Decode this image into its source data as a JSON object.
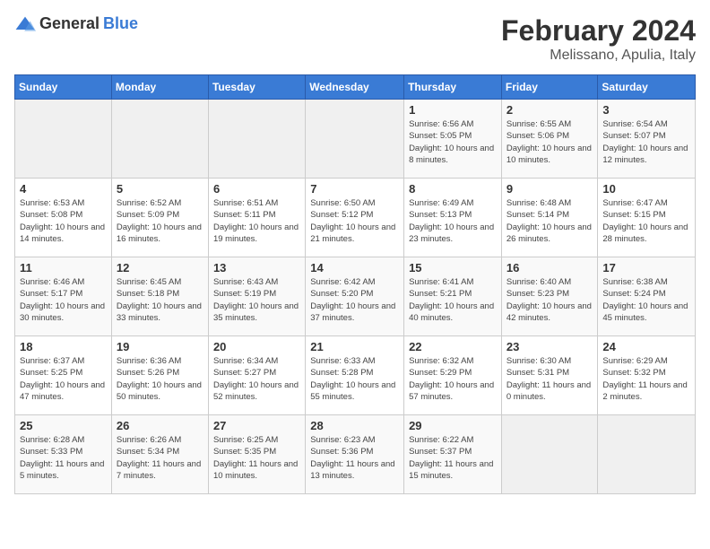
{
  "header": {
    "logo_general": "General",
    "logo_blue": "Blue",
    "month_year": "February 2024",
    "location": "Melissano, Apulia, Italy"
  },
  "days_of_week": [
    "Sunday",
    "Monday",
    "Tuesday",
    "Wednesday",
    "Thursday",
    "Friday",
    "Saturday"
  ],
  "weeks": [
    [
      {
        "day": "",
        "info": ""
      },
      {
        "day": "",
        "info": ""
      },
      {
        "day": "",
        "info": ""
      },
      {
        "day": "",
        "info": ""
      },
      {
        "day": "1",
        "info": "Sunrise: 6:56 AM\nSunset: 5:05 PM\nDaylight: 10 hours and 8 minutes."
      },
      {
        "day": "2",
        "info": "Sunrise: 6:55 AM\nSunset: 5:06 PM\nDaylight: 10 hours and 10 minutes."
      },
      {
        "day": "3",
        "info": "Sunrise: 6:54 AM\nSunset: 5:07 PM\nDaylight: 10 hours and 12 minutes."
      }
    ],
    [
      {
        "day": "4",
        "info": "Sunrise: 6:53 AM\nSunset: 5:08 PM\nDaylight: 10 hours and 14 minutes."
      },
      {
        "day": "5",
        "info": "Sunrise: 6:52 AM\nSunset: 5:09 PM\nDaylight: 10 hours and 16 minutes."
      },
      {
        "day": "6",
        "info": "Sunrise: 6:51 AM\nSunset: 5:11 PM\nDaylight: 10 hours and 19 minutes."
      },
      {
        "day": "7",
        "info": "Sunrise: 6:50 AM\nSunset: 5:12 PM\nDaylight: 10 hours and 21 minutes."
      },
      {
        "day": "8",
        "info": "Sunrise: 6:49 AM\nSunset: 5:13 PM\nDaylight: 10 hours and 23 minutes."
      },
      {
        "day": "9",
        "info": "Sunrise: 6:48 AM\nSunset: 5:14 PM\nDaylight: 10 hours and 26 minutes."
      },
      {
        "day": "10",
        "info": "Sunrise: 6:47 AM\nSunset: 5:15 PM\nDaylight: 10 hours and 28 minutes."
      }
    ],
    [
      {
        "day": "11",
        "info": "Sunrise: 6:46 AM\nSunset: 5:17 PM\nDaylight: 10 hours and 30 minutes."
      },
      {
        "day": "12",
        "info": "Sunrise: 6:45 AM\nSunset: 5:18 PM\nDaylight: 10 hours and 33 minutes."
      },
      {
        "day": "13",
        "info": "Sunrise: 6:43 AM\nSunset: 5:19 PM\nDaylight: 10 hours and 35 minutes."
      },
      {
        "day": "14",
        "info": "Sunrise: 6:42 AM\nSunset: 5:20 PM\nDaylight: 10 hours and 37 minutes."
      },
      {
        "day": "15",
        "info": "Sunrise: 6:41 AM\nSunset: 5:21 PM\nDaylight: 10 hours and 40 minutes."
      },
      {
        "day": "16",
        "info": "Sunrise: 6:40 AM\nSunset: 5:23 PM\nDaylight: 10 hours and 42 minutes."
      },
      {
        "day": "17",
        "info": "Sunrise: 6:38 AM\nSunset: 5:24 PM\nDaylight: 10 hours and 45 minutes."
      }
    ],
    [
      {
        "day": "18",
        "info": "Sunrise: 6:37 AM\nSunset: 5:25 PM\nDaylight: 10 hours and 47 minutes."
      },
      {
        "day": "19",
        "info": "Sunrise: 6:36 AM\nSunset: 5:26 PM\nDaylight: 10 hours and 50 minutes."
      },
      {
        "day": "20",
        "info": "Sunrise: 6:34 AM\nSunset: 5:27 PM\nDaylight: 10 hours and 52 minutes."
      },
      {
        "day": "21",
        "info": "Sunrise: 6:33 AM\nSunset: 5:28 PM\nDaylight: 10 hours and 55 minutes."
      },
      {
        "day": "22",
        "info": "Sunrise: 6:32 AM\nSunset: 5:29 PM\nDaylight: 10 hours and 57 minutes."
      },
      {
        "day": "23",
        "info": "Sunrise: 6:30 AM\nSunset: 5:31 PM\nDaylight: 11 hours and 0 minutes."
      },
      {
        "day": "24",
        "info": "Sunrise: 6:29 AM\nSunset: 5:32 PM\nDaylight: 11 hours and 2 minutes."
      }
    ],
    [
      {
        "day": "25",
        "info": "Sunrise: 6:28 AM\nSunset: 5:33 PM\nDaylight: 11 hours and 5 minutes."
      },
      {
        "day": "26",
        "info": "Sunrise: 6:26 AM\nSunset: 5:34 PM\nDaylight: 11 hours and 7 minutes."
      },
      {
        "day": "27",
        "info": "Sunrise: 6:25 AM\nSunset: 5:35 PM\nDaylight: 11 hours and 10 minutes."
      },
      {
        "day": "28",
        "info": "Sunrise: 6:23 AM\nSunset: 5:36 PM\nDaylight: 11 hours and 13 minutes."
      },
      {
        "day": "29",
        "info": "Sunrise: 6:22 AM\nSunset: 5:37 PM\nDaylight: 11 hours and 15 minutes."
      },
      {
        "day": "",
        "info": ""
      },
      {
        "day": "",
        "info": ""
      }
    ]
  ]
}
